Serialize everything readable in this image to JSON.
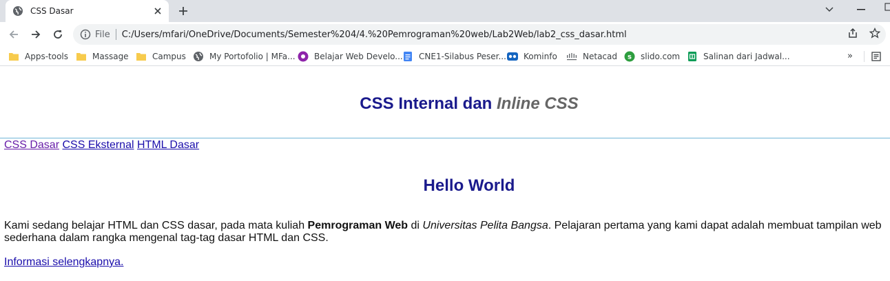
{
  "browser": {
    "tab": {
      "title": "CSS Dasar"
    },
    "address": {
      "scheme_label": "File",
      "url": "C:/Users/mfari/OneDrive/Documents/Semester%204/4.%20Pemrograman%20web/Lab2Web/lab2_css_dasar.html"
    },
    "bookmarks": [
      {
        "label": "Apps-tools",
        "icon": "folder-icon"
      },
      {
        "label": "Massage",
        "icon": "folder-icon"
      },
      {
        "label": "Campus",
        "icon": "folder-icon"
      },
      {
        "label": "My Portofolio | MFa...",
        "icon": "globe-icon"
      },
      {
        "label": "Belajar Web Develo...",
        "icon": "purple-circle-icon"
      },
      {
        "label": "CNE1-Silabus Peser...",
        "icon": "docs-icon"
      },
      {
        "label": "Kominfo",
        "icon": "kominfo-icon"
      },
      {
        "label": "Netacad",
        "icon": "cisco-icon"
      },
      {
        "label": "slido.com",
        "icon": "slido-icon"
      },
      {
        "label": "Salinan dari Jadwal...",
        "icon": "sheets-icon"
      }
    ],
    "bookmarks_overflow": "»"
  },
  "page": {
    "header": {
      "title_main": "CSS Internal dan ",
      "title_em": "Inline CSS"
    },
    "nav": [
      "CSS Dasar",
      "CSS Eksternal",
      "HTML Dasar"
    ],
    "hello": "Hello World",
    "paragraph": {
      "p1": "Kami sedang belajar HTML dan CSS dasar, pada mata kuliah ",
      "strong": "Pemrograman Web",
      "p2": " di ",
      "em": "Universitas Pelita Bangsa",
      "p3": ". Pelajaran pertama yang kami dapat adalah membuat tampilan web sederhana dalam rangka mengenal tag-tag dasar HTML dan CSS."
    },
    "more_link": "Informasi selengkapnya."
  },
  "colors": {
    "heading": "#1a1a8c",
    "heading_em": "#666666",
    "link": "#1a0dab",
    "link_visited": "#681da8",
    "rule": "#6fb6d6"
  }
}
